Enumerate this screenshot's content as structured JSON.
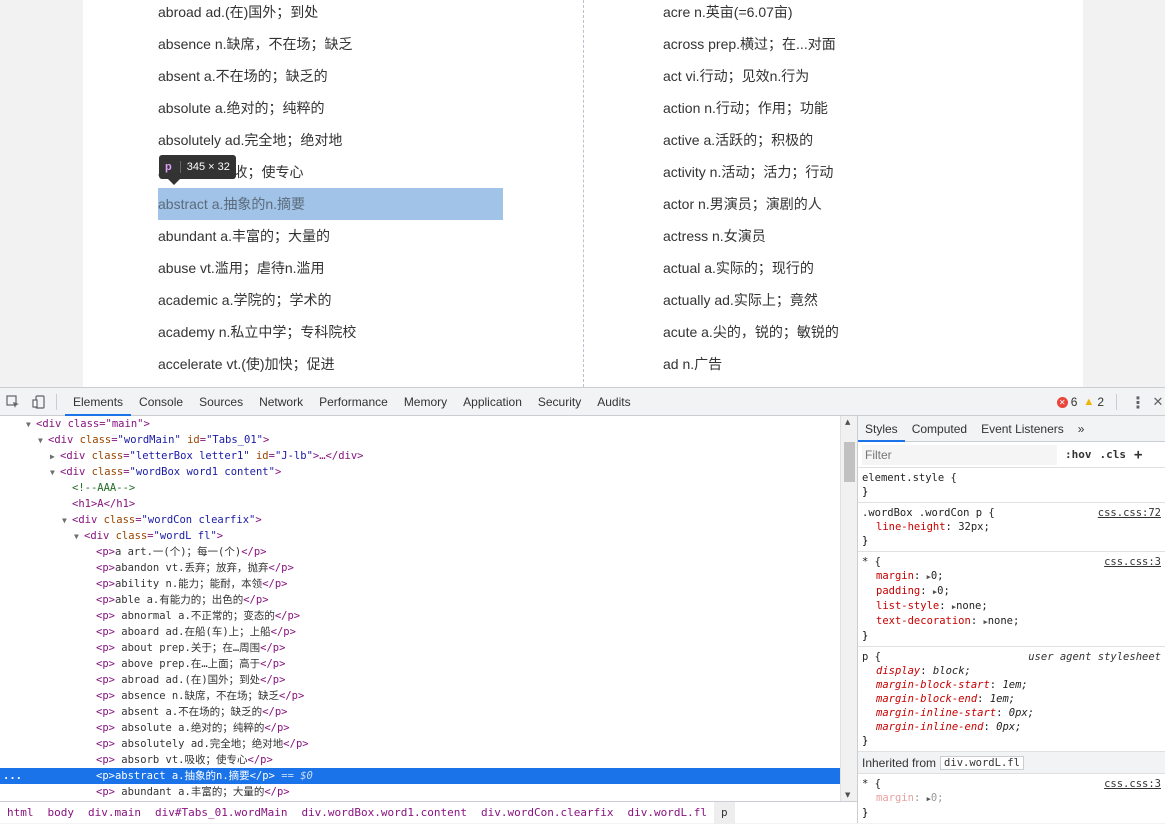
{
  "page": {
    "left_words": [
      "abroad ad.(在)国外；到处",
      "absence n.缺席，不在场；缺乏",
      "absent a.不在场的；缺乏的",
      "absolute a.绝对的；纯粹的",
      "absolutely ad.完全地；绝对地",
      "absorb vt.吸收；使专心",
      "abstract a.抽象的n.摘要",
      "abundant a.丰富的；大量的",
      "abuse vt.滥用；虐待n.滥用",
      "academic a.学院的；学术的",
      "academy n.私立中学；专科院校",
      "accelerate vt.(使)加快；促进"
    ],
    "right_words": [
      "acre n.英亩(=6.07亩)",
      "across prep.横过；在...对面",
      "act vi.行动；见效n.行为",
      "action n.行动；作用；功能",
      "active a.活跃的；积极的",
      "activity n.活动；活力；行动",
      "actor n.男演员；演剧的人",
      "actress n.女演员",
      "actual a.实际的；现行的",
      "actually ad.实际上；竟然",
      "acute a.尖的，锐的；敏锐的",
      "ad n.广告"
    ],
    "highlight_index": 6,
    "tooltip": {
      "tag": "p",
      "size": "345 × 32"
    }
  },
  "devtools": {
    "tabs": [
      "Elements",
      "Console",
      "Sources",
      "Network",
      "Performance",
      "Memory",
      "Application",
      "Security",
      "Audits"
    ],
    "active_tab": "Elements",
    "errors": "6",
    "warnings": "2",
    "dom": {
      "main_open": "<div class=\"main\">",
      "wordmain": {
        "tag": "div",
        "a1": "class",
        "v1": "\"wordMain\"",
        "a2": "id",
        "v2": "\"Tabs_01\""
      },
      "letterbox": {
        "tag": "div",
        "a1": "class",
        "v1": "\"letterBox letter1\"",
        "a2": "id",
        "v2": "\"J-lb\"",
        "rest": "…</div>"
      },
      "wordbox": {
        "tag": "div",
        "a1": "class",
        "v1": "\"wordBox word1 content\""
      },
      "comment": "<!--AAA-->",
      "h1": "<h1>A</h1>",
      "wordcon": {
        "tag": "div",
        "a1": "class",
        "v1": "\"wordCon clearfix\""
      },
      "wordl": {
        "tag": "div",
        "a1": "class",
        "v1": "\"wordL fl\""
      },
      "p_lines": [
        "a art.一(个)；每一(个)",
        "abandon vt.丢弃；放弃，抛弃",
        "ability n.能力；能耐，本领",
        "able a.有能力的；出色的",
        " abnormal a.不正常的；变态的",
        " aboard ad.在船(车)上；上船",
        " about prep.关于；在…周围",
        " above prep.在…上面；高于",
        " abroad ad.(在)国外；到处",
        " absence n.缺席，不在场；缺乏",
        " absent a.不在场的；缺乏的",
        " absolute a.绝对的；纯粹的",
        " absolutely ad.完全地；绝对地",
        " absorb vt.吸收；使专心",
        "abstract a.抽象的n.摘要",
        " abundant a.丰富的；大量的"
      ],
      "selected_index": 14,
      "selected_suffix": " == $0",
      "selected_dots": "..."
    },
    "breadcrumbs": [
      "html",
      "body",
      "div.main",
      "div#Tabs_01.wordMain",
      "div.wordBox.word1.content",
      "div.wordCon.clearfix",
      "div.wordL.fl",
      "p"
    ],
    "styles": {
      "tabs": [
        "Styles",
        "Computed",
        "Event Listeners"
      ],
      "more": "»",
      "filter_placeholder": "Filter",
      "hov": ":hov",
      "cls": ".cls",
      "plus": "+",
      "element_style": "element.style {",
      "close": "}",
      "rule1": {
        "selector": ".wordBox .wordCon p {",
        "source": "css.css:72",
        "decls": [
          {
            "p": "line-height",
            "v": "32px;"
          }
        ]
      },
      "rule2": {
        "selector": "* {",
        "source": "css.css:3",
        "decls": [
          {
            "p": "margin",
            "v": "0;"
          },
          {
            "p": "padding",
            "v": "0;"
          },
          {
            "p": "list-style",
            "v": "none;"
          },
          {
            "p": "text-decoration",
            "v": "none;"
          }
        ]
      },
      "rule3": {
        "selector": "p {",
        "source": "user agent stylesheet",
        "decls": [
          {
            "p": "display",
            "v": "block;"
          },
          {
            "p": "margin-block-start",
            "v": "1em;"
          },
          {
            "p": "margin-block-end",
            "v": "1em;"
          },
          {
            "p": "margin-inline-start",
            "v": "0px;"
          },
          {
            "p": "margin-inline-end",
            "v": "0px;"
          }
        ]
      },
      "inherited_label": "Inherited from",
      "inherited_selector": "div.wordL.fl",
      "rule4": {
        "selector": "* {",
        "source": "css.css:3",
        "decls": [
          {
            "p": "margin",
            "v": "0;"
          }
        ]
      }
    }
  },
  "colors": {
    "highlight": "#a1c3e8",
    "selection": "#1a73e8",
    "tag": "#881280",
    "attr_name": "#994500",
    "attr_value": "#1a1aa6"
  }
}
